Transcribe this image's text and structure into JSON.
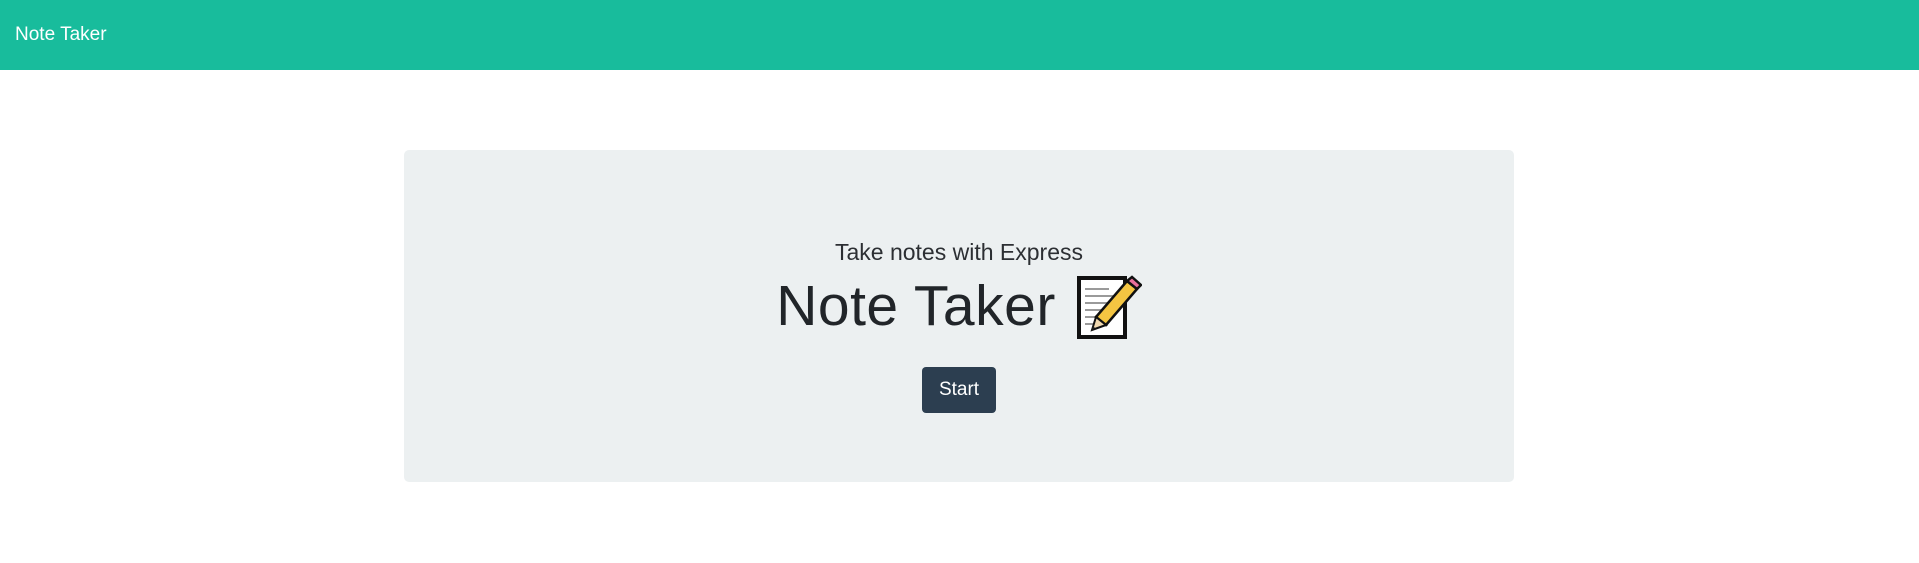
{
  "navbar": {
    "brand": "Note Taker",
    "bg_color": "#18bc9c"
  },
  "hero": {
    "subtitle": "Take notes with Express",
    "title": "Note Taker",
    "title_icon": "memo-icon",
    "bg_color": "#ecf0f1"
  },
  "actions": {
    "start_label": "Start",
    "start_color": "#2c3e50"
  }
}
